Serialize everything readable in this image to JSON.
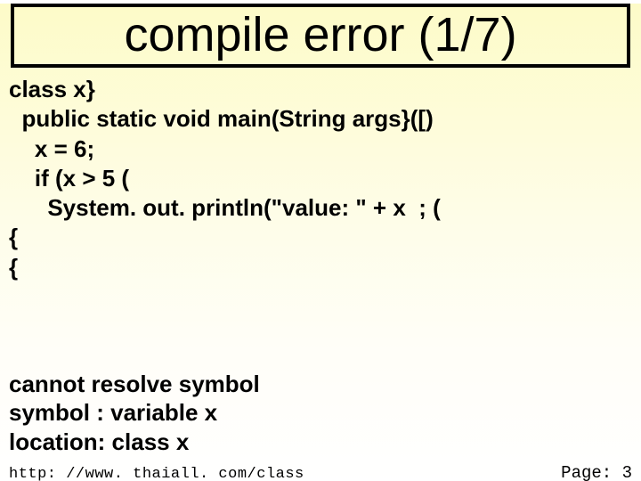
{
  "title": "compile error (1/7)",
  "code": {
    "l1": "class x}",
    "l2": "  public static void main(String args}([)",
    "l3": "    x = 6;",
    "l4": "    if (x > 5 (",
    "l5": "      System. out. println(\"value: \" + x  ; (",
    "l6": "{",
    "l7": "{"
  },
  "error": {
    "l1": "cannot resolve symbol",
    "l2": "symbol  : variable x",
    "l3": "location: class x"
  },
  "footer": {
    "url": "http: //www. thaiall. com/class",
    "page_label": "Page: 3"
  }
}
